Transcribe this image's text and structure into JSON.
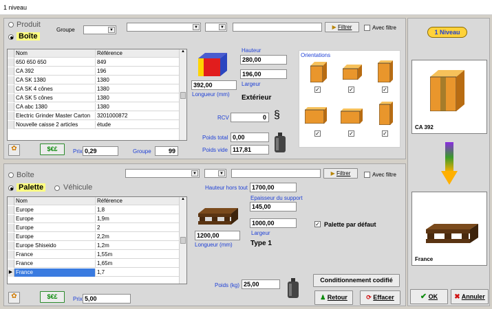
{
  "window": {
    "title": "1 niveau"
  },
  "top": {
    "radio_produit": "Produit",
    "radio_boite": "Boîte",
    "groupe_label": "Groupe",
    "filtrer_label": "Filtrer",
    "avec_filtre_label": "Avec filtre",
    "columns": [
      "Nom",
      "Référence"
    ],
    "rows": [
      {
        "nom": "650 650 650",
        "ref": "849"
      },
      {
        "nom": "CA 392",
        "ref": "196"
      },
      {
        "nom": "CA SK 1380",
        "ref": "1380"
      },
      {
        "nom": "CA SK 4 cônes",
        "ref": "1380"
      },
      {
        "nom": "CA SK 5 cônes",
        "ref": "1380"
      },
      {
        "nom": "CA abc 1380",
        "ref": "1380"
      },
      {
        "nom": "Electric Grinder Master Carton",
        "ref": "3201000872"
      },
      {
        "nom": "Nouvelle caisse 2 articles",
        "ref": "étude"
      }
    ],
    "prix_label": "Prix",
    "prix_value": "0,29",
    "groupe_bottom_label": "Groupe",
    "groupe_value": "99",
    "money_label": "$€£",
    "hauteur_label": "Hauteur",
    "hauteur_value": "280,00",
    "largeur_value": "196,00",
    "largeur_label": "Largeur",
    "longueur_value": "392,00",
    "longueur_label": "Longueur (mm)",
    "exterieur_label": "Extérieur",
    "rcv_label": "RCV",
    "rcv_value": "0",
    "poids_total_label": "Poids total",
    "poids_total_value": "0,00",
    "poids_vide_label": "Poids vide",
    "poids_vide_value": "117,81",
    "orientations_label": "Orientations"
  },
  "bottom": {
    "radio_boite": "Boîte",
    "radio_palette": "Palette",
    "radio_vehicule": "Véhicule",
    "filtrer_label": "Filtrer",
    "avec_filtre_label": "Avec filtre",
    "columns": [
      "Nom",
      "Référence"
    ],
    "rows": [
      {
        "nom": "Europe",
        "ref": "1,8"
      },
      {
        "nom": "Europe",
        "ref": "1,9m"
      },
      {
        "nom": "Europe",
        "ref": "2"
      },
      {
        "nom": "Europe",
        "ref": "2,2m"
      },
      {
        "nom": "Europe Shiseido",
        "ref": "1,2m"
      },
      {
        "nom": "France",
        "ref": "1,55m"
      },
      {
        "nom": "France",
        "ref": "1,65m"
      },
      {
        "nom": "France",
        "ref": "1,7"
      }
    ],
    "prix_label": "Prix",
    "prix_value": "5,00",
    "money_label": "$€£",
    "hauteur_hors_tout_label": "Hauteur hors tout",
    "hauteur_hors_tout_value": "1700,00",
    "epaisseur_label": "Epaisseur du support",
    "epaisseur_value": "145,00",
    "largeur_value": "1000,00",
    "largeur_label": "Largeur",
    "longueur_value": "1200,00",
    "longueur_label": "Longueur (mm)",
    "type_label": "Type 1",
    "palette_defaut_label": "Palette par défaut",
    "poids_label": "Poids (kg)",
    "poids_value": "25,00",
    "conditionnement_label": "Conditionnement codifié",
    "retour_label": "Retour",
    "effacer_label": "Effacer"
  },
  "right": {
    "niveau_label": "1 Niveau",
    "box_caption": "CA 392",
    "pallet_caption": "France",
    "ok_label": "OK",
    "annuler_label": "Annuler"
  },
  "colors": {
    "accent_blue": "#1d3fd6",
    "selection": "#3a7be0",
    "highlight_yellow": "#ffff80",
    "box_orange": "#e8a13a"
  }
}
